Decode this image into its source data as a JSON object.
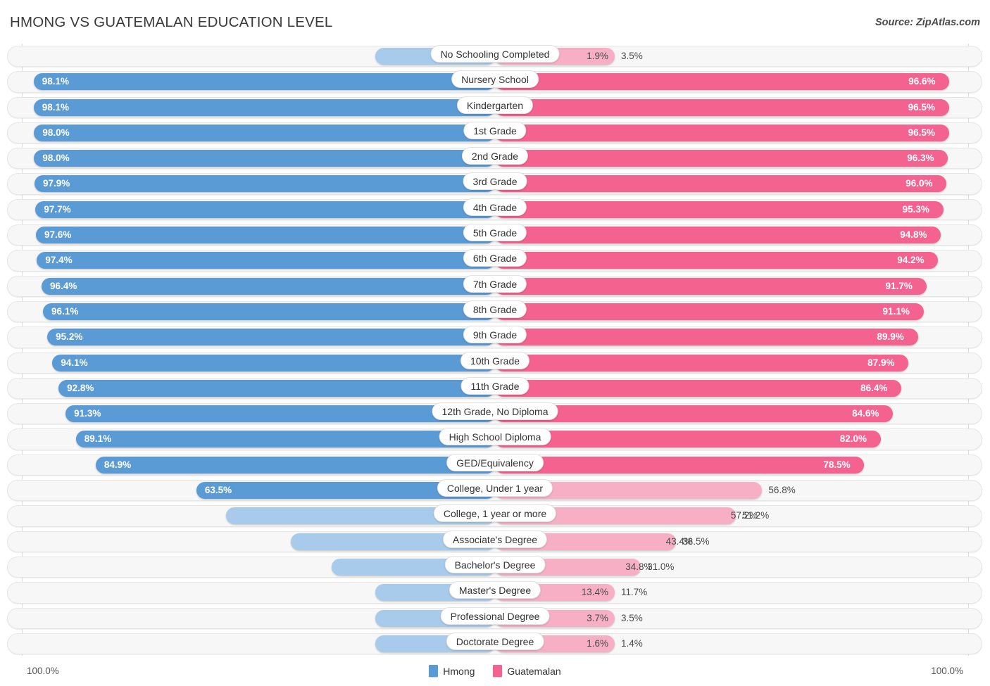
{
  "header": {
    "title": "HMONG VS GUATEMALAN EDUCATION LEVEL",
    "source": "Source: ZipAtlas.com"
  },
  "footer": {
    "axis_min": "100.0%",
    "axis_max": "100.0%"
  },
  "legend": {
    "items": [
      {
        "label": "Hmong",
        "color": "#5B9BD5"
      },
      {
        "label": "Guatemalan",
        "color": "#F4628F"
      }
    ]
  },
  "colors": {
    "hmong_strong": "#5B9BD5",
    "hmong_light": "#A8CBEC",
    "guatemalan_strong": "#F4628F",
    "guatemalan_light": "#F7AFC6",
    "track": "#F7F7F7",
    "gridline": "#DCDCDC"
  },
  "chart_data": {
    "type": "bar",
    "orientation": "horizontal-diverging",
    "title": "HMONG VS GUATEMALAN EDUCATION LEVEL",
    "xlabel": "",
    "ylabel": "",
    "xlim": [
      0,
      100
    ],
    "grid": true,
    "legend_position": "bottom-center",
    "axis_min_label": "100.0%",
    "axis_max_label": "100.0%",
    "categories": [
      "No Schooling Completed",
      "Nursery School",
      "Kindergarten",
      "1st Grade",
      "2nd Grade",
      "3rd Grade",
      "4th Grade",
      "5th Grade",
      "6th Grade",
      "7th Grade",
      "8th Grade",
      "9th Grade",
      "10th Grade",
      "11th Grade",
      "12th Grade, No Diploma",
      "High School Diploma",
      "GED/Equivalency",
      "College, Under 1 year",
      "College, 1 year or more",
      "Associate's Degree",
      "Bachelor's Degree",
      "Master's Degree",
      "Professional Degree",
      "Doctorate Degree"
    ],
    "series": [
      {
        "name": "Hmong",
        "color": "#5B9BD5",
        "values": [
          1.9,
          98.1,
          98.1,
          98.0,
          98.0,
          97.9,
          97.7,
          97.6,
          97.4,
          96.4,
          96.1,
          95.2,
          94.1,
          92.8,
          91.3,
          89.1,
          84.9,
          63.5,
          57.2,
          43.4,
          34.8,
          13.4,
          3.7,
          1.6
        ],
        "labels": [
          "1.9%",
          "98.1%",
          "98.1%",
          "98.0%",
          "98.0%",
          "97.9%",
          "97.7%",
          "97.6%",
          "97.4%",
          "96.4%",
          "96.1%",
          "95.2%",
          "94.1%",
          "92.8%",
          "91.3%",
          "89.1%",
          "84.9%",
          "63.5%",
          "57.2%",
          "43.4%",
          "34.8%",
          "13.4%",
          "3.7%",
          "1.6%"
        ]
      },
      {
        "name": "Guatemalan",
        "color": "#F4628F",
        "values": [
          3.5,
          96.6,
          96.5,
          96.5,
          96.3,
          96.0,
          95.3,
          94.8,
          94.2,
          91.7,
          91.1,
          89.9,
          87.9,
          86.4,
          84.6,
          82.0,
          78.5,
          56.8,
          51.2,
          38.5,
          31.0,
          11.7,
          3.5,
          1.4
        ],
        "labels": [
          "3.5%",
          "96.6%",
          "96.5%",
          "96.5%",
          "96.3%",
          "96.0%",
          "95.3%",
          "94.8%",
          "94.2%",
          "91.7%",
          "91.1%",
          "89.9%",
          "87.9%",
          "86.4%",
          "84.6%",
          "82.0%",
          "78.5%",
          "56.8%",
          "51.2%",
          "38.5%",
          "31.0%",
          "11.7%",
          "3.5%",
          "1.4%"
        ]
      }
    ]
  }
}
